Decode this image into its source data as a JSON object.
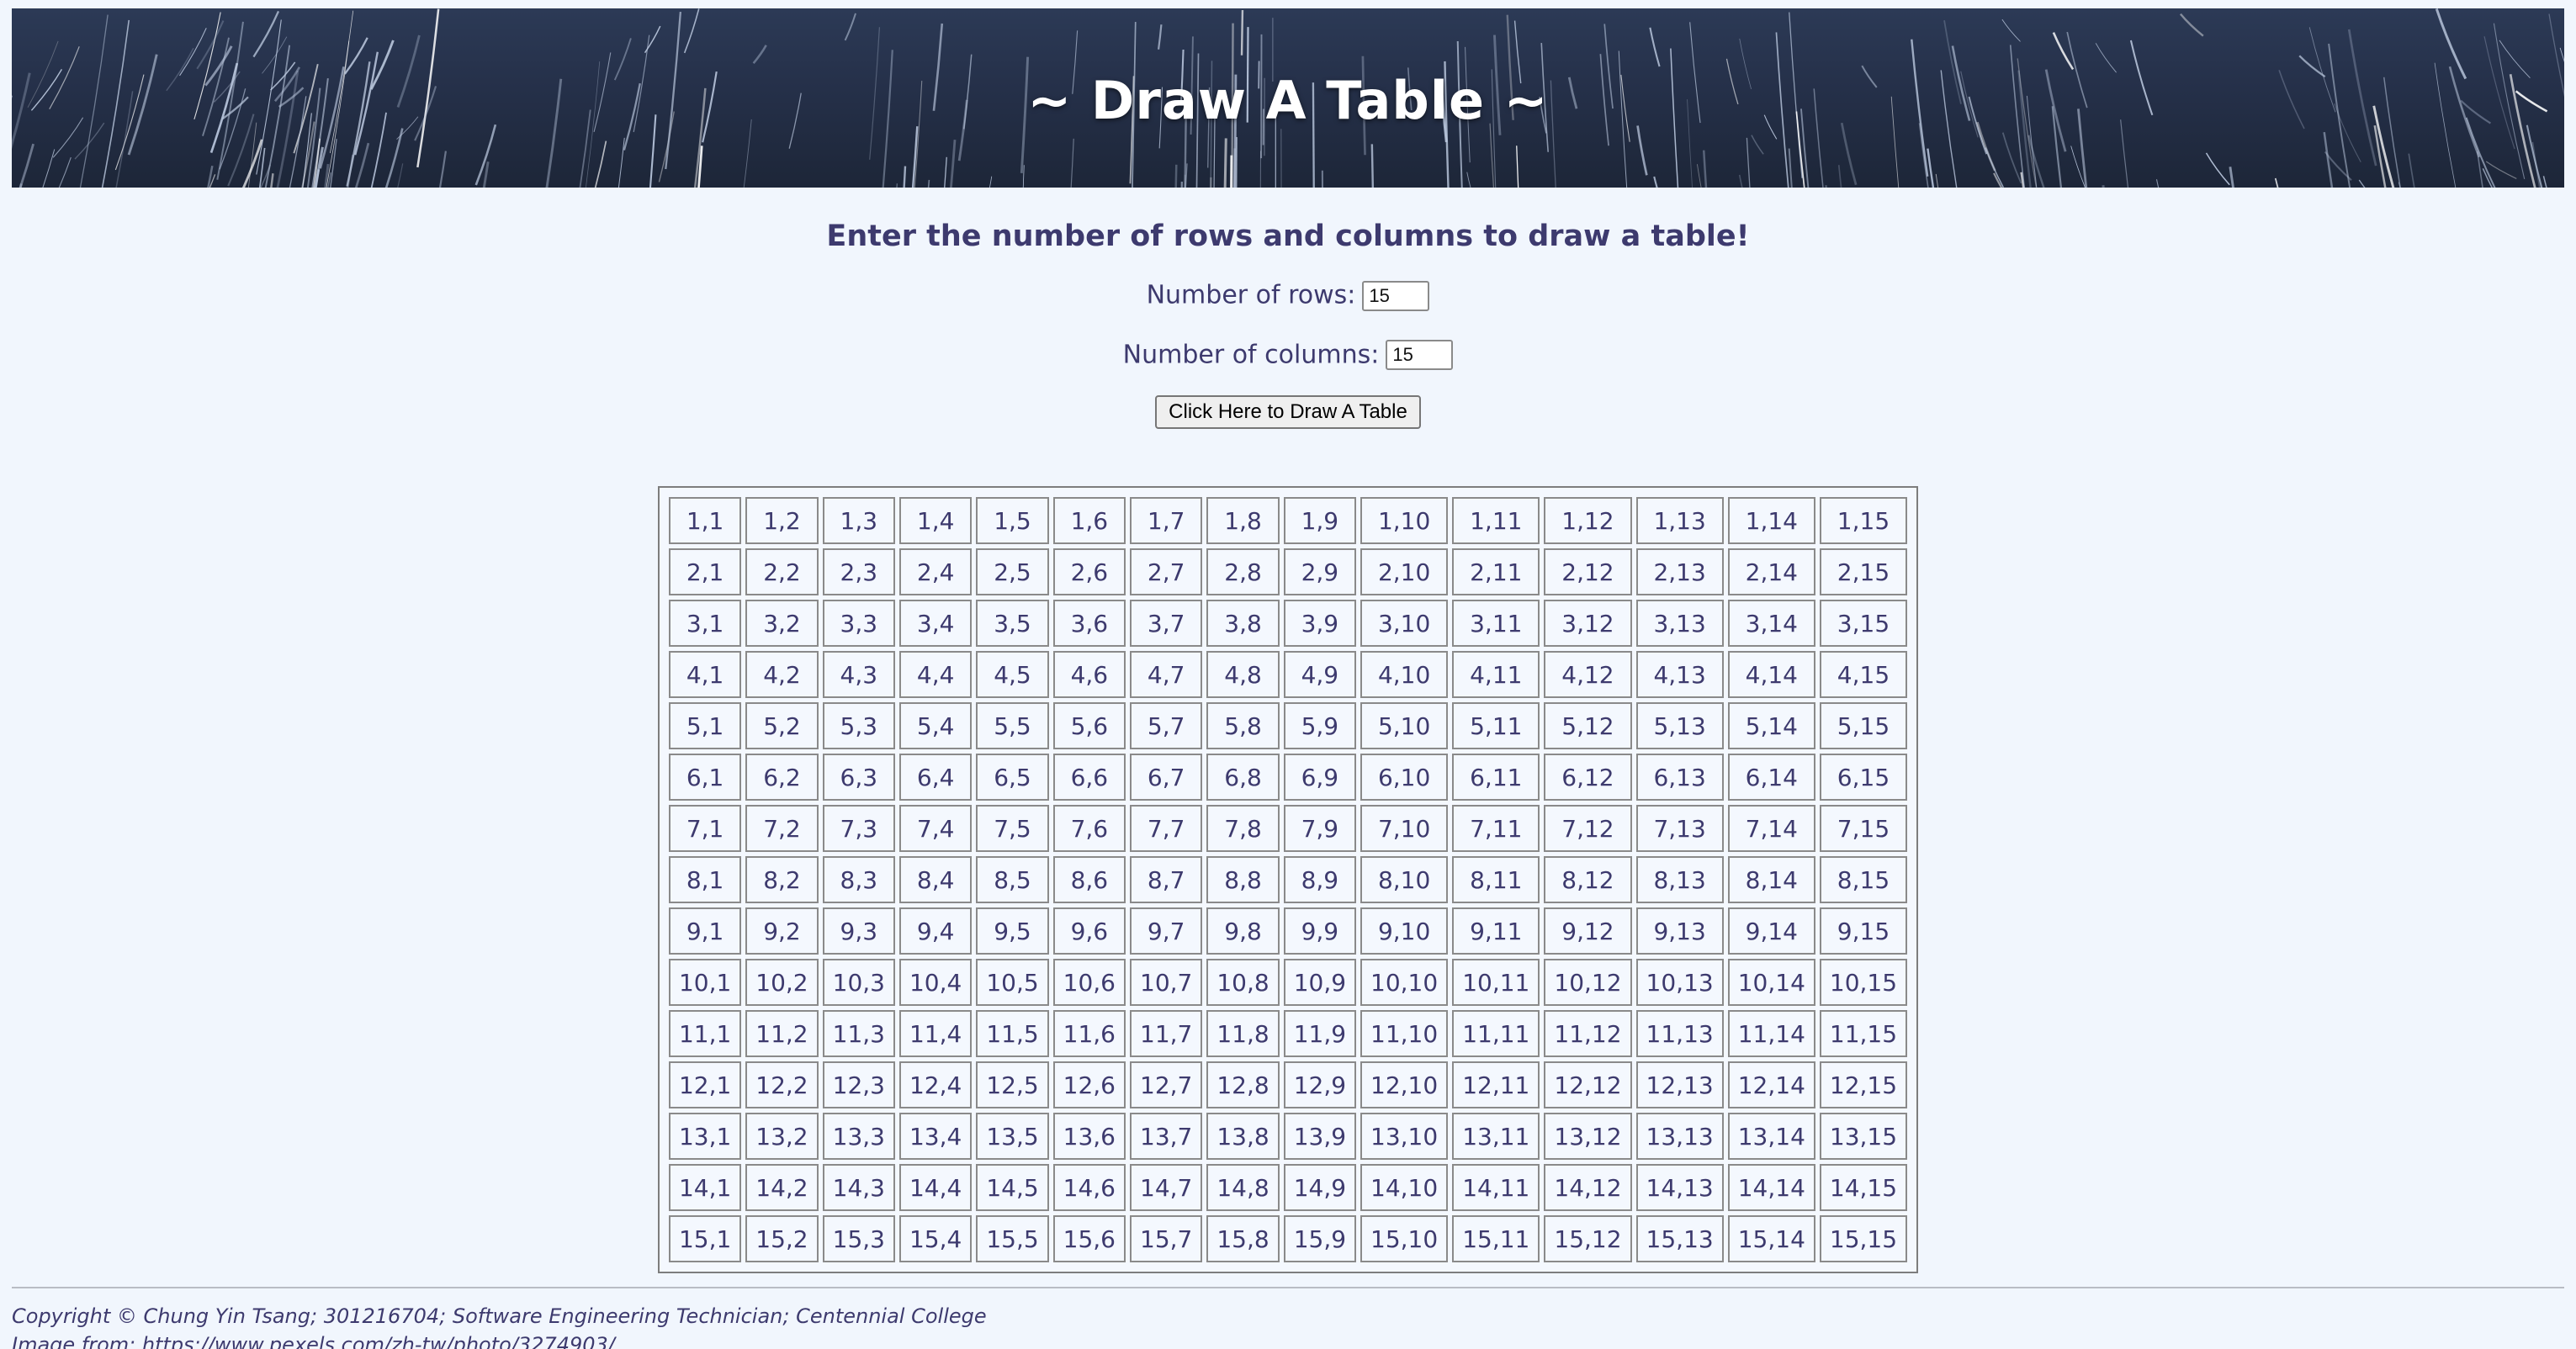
{
  "banner": {
    "title": "~ Draw A Table ~"
  },
  "form": {
    "heading": "Enter the number of rows and columns to draw a table!",
    "rows_label": "Number of rows:",
    "rows_value": "15",
    "cols_label": "Number of columns:",
    "cols_value": "15",
    "draw_button_label": "Click Here to Draw A Table"
  },
  "table": {
    "rows": 15,
    "cols": 15,
    "cell_format": "{row},{col}"
  },
  "footer": {
    "copyright": "Copyright © Chung Yin Tsang; 301216704; Software Engineering Technician; Centennial College",
    "image_credit": "Image from: https://www.pexels.com/zh-tw/photo/3274903/"
  },
  "colors": {
    "page_background": "#f1f6fd",
    "text": "#3d3a6e",
    "banner_dark": "#253049"
  }
}
